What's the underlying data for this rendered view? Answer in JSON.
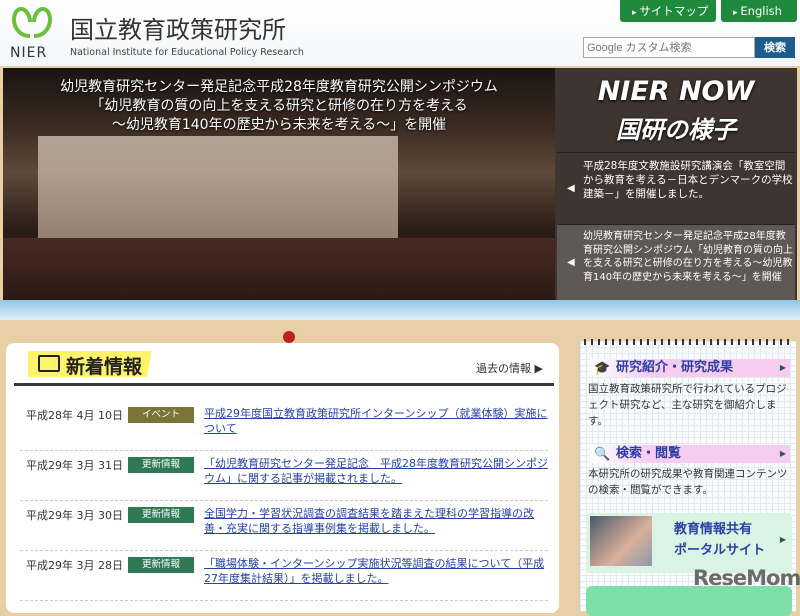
{
  "header": {
    "logo_text": "NIER",
    "org_name_ja": "国立教育政策研究所",
    "org_name_en": "National Institute for Educational Policy Research",
    "sitemap": "サイトマップ",
    "english": "English",
    "search_placeholder": "Google カスタム検索",
    "search_button": "検索"
  },
  "banner": {
    "lines": [
      "幼児教育研究センター発足記念平成28年度教育研究公開シンポジウム",
      "「幼児教育の質の向上を支える研究と研修の在り方を考える",
      "～幼児教育140年の歴史から未来を考える～」を開催"
    ]
  },
  "nier_now": {
    "title1": "NIER NOW",
    "title2": "国研の様子",
    "items": [
      {
        "text": "平成28年度文教施設研究講演会「教室空間から教育を考える－日本とデンマークの学校建築－」を開催しました。"
      },
      {
        "text": "幼児教育研究センター発足記念平成28年度教育研究公開シンポジウム「幼児教育の質の向上を支える研究と研修の在り方を考える～幼児教育140年の歴史から未来を考える～」を開催"
      }
    ]
  },
  "news": {
    "title": "新着情報",
    "past_link": "過去の情報 ▶",
    "items": [
      {
        "date": "平成28年 4月 10日",
        "badge": "イベント",
        "badge_color": "#7a7436",
        "title": "平成29年度国立教育政策研究所インターンシップ（就業体験）実施について"
      },
      {
        "date": "平成29年 3月 31日",
        "badge": "更新情報",
        "badge_color": "#2d7a54",
        "title": "「幼児教育研究センター発足記念　平成28年度教育研究公開シンポジウム」に関する記事が掲載されました。"
      },
      {
        "date": "平成29年 3月 30日",
        "badge": "更新情報",
        "badge_color": "#2d7a54",
        "title": "全国学力・学習状況調査の調査結果を踏まえた理科の学習指導の改善・充実に関する指導事例集を掲載しました。"
      },
      {
        "date": "平成29年 3月 28日",
        "badge": "更新情報",
        "badge_color": "#2d7a54",
        "title": "「職場体験・インターンシップ実施状況等調査の結果について（平成27年度集計結果）」を掲載しました。"
      }
    ]
  },
  "side": {
    "research_title": "研究紹介・研究成果",
    "research_desc": "国立教育政策研究所で行われているプロジェクト研究など、主な研究を御紹介します。",
    "search_title": "検索・閲覧",
    "search_desc": "本研究所の研究成果や教育関連コンテンツの検索・閲覧ができます。",
    "portal_line1": "教育情報共有",
    "portal_line2": "ポータルサイト"
  },
  "watermark": "ReseMom"
}
